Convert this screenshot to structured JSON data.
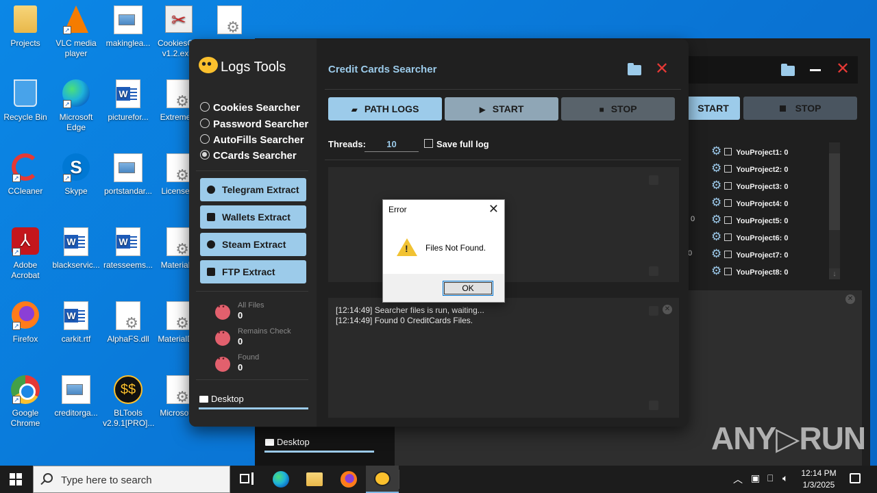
{
  "desktop": {
    "icons": [
      {
        "label": "Projects"
      },
      {
        "label": "VLC media player"
      },
      {
        "label": "makinglea..."
      },
      {
        "label": "CookiesC... v1.2.ex..."
      },
      {
        "label": ""
      },
      {
        "label": "Recycle Bin"
      },
      {
        "label": "Microsoft Edge"
      },
      {
        "label": "picturefor..."
      },
      {
        "label": "Extreme..."
      },
      {
        "label": "CCleaner"
      },
      {
        "label": "Skype"
      },
      {
        "label": "portstandar..."
      },
      {
        "label": "License..."
      },
      {
        "label": "Adobe Acrobat"
      },
      {
        "label": "blackservic..."
      },
      {
        "label": "ratesseems..."
      },
      {
        "label": "Material..."
      },
      {
        "label": "Firefox"
      },
      {
        "label": "carkit.rtf"
      },
      {
        "label": "AlphaFS.dll"
      },
      {
        "label": "MaterialD..."
      },
      {
        "label": "Google Chrome"
      },
      {
        "label": "creditorga..."
      },
      {
        "label": "BLTools v2.9.1[PRO]..."
      },
      {
        "label": "Microsof..."
      }
    ]
  },
  "bg_window": {
    "start_label": "START",
    "stop_label": "STOP",
    "projects": [
      "YouProject1: 0",
      "YouProject2: 0",
      "YouProject3: 0",
      "YouProject4: 0",
      "YouProject5: 0",
      "YouProject6: 0",
      "YouProject7: 0",
      "YouProject8: 0"
    ],
    "stray_zero_1": "0",
    "stray_zero_2": "0",
    "path_label": "Desktop"
  },
  "app": {
    "title": "Logs Tools",
    "modes": [
      {
        "label": "Cookies Searcher",
        "selected": false
      },
      {
        "label": "Password Searcher",
        "selected": false
      },
      {
        "label": "AutoFills Searcher",
        "selected": false
      },
      {
        "label": "CCards Searcher",
        "selected": true
      }
    ],
    "extract_buttons": [
      "Telegram Extract",
      "Wallets Extract",
      "Steam Extract",
      "FTP Extract"
    ],
    "stats": [
      {
        "label": "All Files",
        "value": "0"
      },
      {
        "label": "Remains Check",
        "value": "0"
      },
      {
        "label": "Found",
        "value": "0"
      }
    ],
    "path_label": "Desktop",
    "section_title": "Credit Cards Searcher",
    "path_logs_label": "PATH LOGS",
    "start_label": "START",
    "stop_label": "STOP",
    "threads_label": "Threads:",
    "threads_value": "10",
    "save_full_log_label": "Save full log",
    "log_lines": [
      "[12:14:49] Searcher files is run, waiting...",
      "[12:14:49] Found 0 CreditCards Files."
    ],
    "accent_color": "#9ccbea",
    "close_color": "#e53935"
  },
  "dialog": {
    "title": "Error",
    "message": "Files Not Found.",
    "ok_label": "OK",
    "close_glyph": "✕"
  },
  "watermark": "ANY▷RUN",
  "taskbar": {
    "search_placeholder": "Type here to search",
    "time": "12:14 PM",
    "date": "1/3/2025"
  }
}
